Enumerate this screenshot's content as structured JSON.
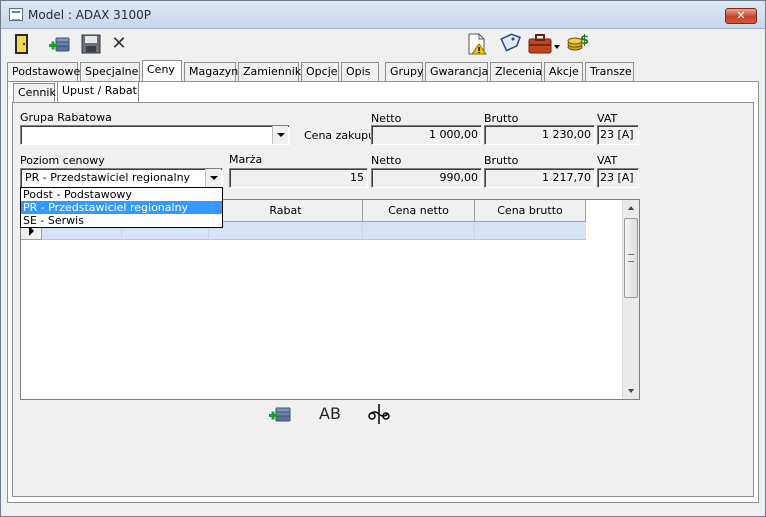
{
  "window": {
    "title": "Model : ADAX 3100P",
    "close_label": "✕"
  },
  "toolbar": {
    "icons": [
      "exit-door-icon",
      "add-product-icon",
      "save-disk-icon",
      "delete-x-icon",
      "warning-document-icon",
      "tag-label-icon",
      "briefcase-dropdown-icon",
      "money-coins-icon"
    ],
    "delete_glyph": "✕"
  },
  "tabs": [
    "Podstawowe",
    "Specjalne",
    "Ceny",
    "Magazyn",
    "Zamienniki",
    "Opcje",
    "Opis",
    "Grupy",
    "Gwarancja",
    "Zlecenia",
    "Akcje",
    "Transze"
  ],
  "active_tab": "Ceny",
  "subtabs": [
    "Cennik",
    "Upust / Rabat"
  ],
  "active_subtab": "Upust / Rabat",
  "form": {
    "grupa_rabatowa_label": "Grupa Rabatowa",
    "grupa_rabatowa_value": "",
    "cena_zakupu_label": "Cena zakupu",
    "netto_label": "Netto",
    "brutto_label": "Brutto",
    "vat_label": "VAT",
    "zakup_netto": "1 000,00",
    "zakup_brutto": "1 230,00",
    "zakup_vat": "23 [A]",
    "poziom_label": "Poziom cenowy",
    "poziom_value": "PR - Przedstawiciel regionalny",
    "marza_label": "Marża",
    "marza_value": "15",
    "poziom_netto": "990,00",
    "poziom_brutto": "1 217,70",
    "poziom_vat": "23 [A]"
  },
  "dropdown_options": [
    "Podst - Podstawowy",
    "PR - Przedstawiciel regionalny",
    "SE - Serwis"
  ],
  "dropdown_selected_index": 1,
  "grid": {
    "columns": [
      "Rabat",
      "Cena netto",
      "Cena brutto"
    ]
  },
  "bottom_icons": [
    "add-row-icon",
    "rename-ab-icon",
    "cut-scissors-icon"
  ],
  "rename_text": "AB"
}
